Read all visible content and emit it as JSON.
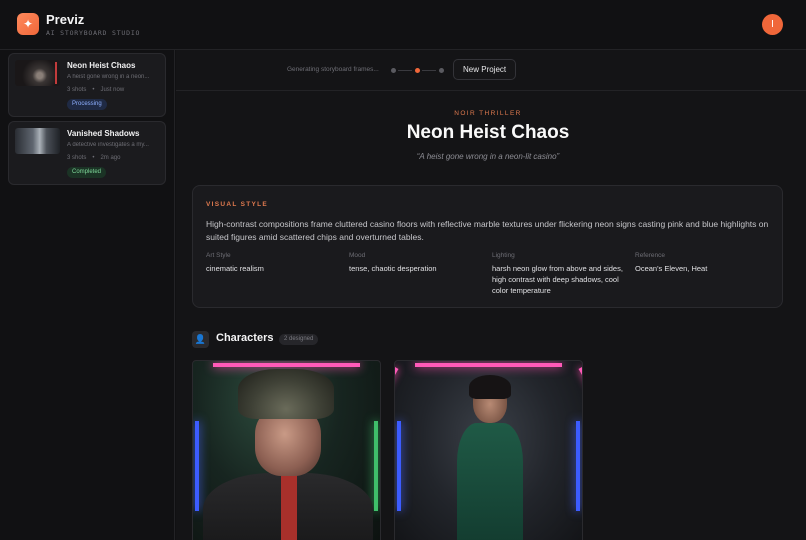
{
  "app": {
    "name": "Previz",
    "tagline": "AI STORYBOARD STUDIO",
    "logo_icon": "sparkle-icon",
    "accent": "#f0673a"
  },
  "user": {
    "initial": "I"
  },
  "projects": [
    {
      "title": "Neon Heist Chaos",
      "desc": "A heist gone wrong in a neon...",
      "shots": "3 shots",
      "time": "Just now",
      "status": "Processing"
    },
    {
      "title": "Vanished Shadows",
      "desc": "A detective investigates a my...",
      "shots": "3 shots",
      "time": "2m ago",
      "status": "Completed"
    }
  ],
  "toolbar": {
    "generating_text": "Generating storyboard frames...",
    "new_project_label": "New Project"
  },
  "story": {
    "genre": "NOIR THRILLER",
    "title": "Neon Heist Chaos",
    "logline": "“A heist gone wrong in a neon-lit casino”"
  },
  "visual_style": {
    "label": "VISUAL STYLE",
    "description": "High-contrast compositions frame cluttered casino floors with reflective marble textures under flickering neon signs casting pink and blue highlights on suited figures amid scattered chips and overturned tables.",
    "attributes": [
      {
        "key": "Art Style",
        "value": "cinematic realism"
      },
      {
        "key": "Mood",
        "value": "tense, chaotic desperation"
      },
      {
        "key": "Lighting",
        "value": "harsh neon glow from above and sides, high contrast with deep shadows, cool color temperature"
      },
      {
        "key": "Reference",
        "value": "Ocean's Eleven, Heat"
      }
    ]
  },
  "characters": {
    "title": "Characters",
    "count": "2 designed"
  }
}
